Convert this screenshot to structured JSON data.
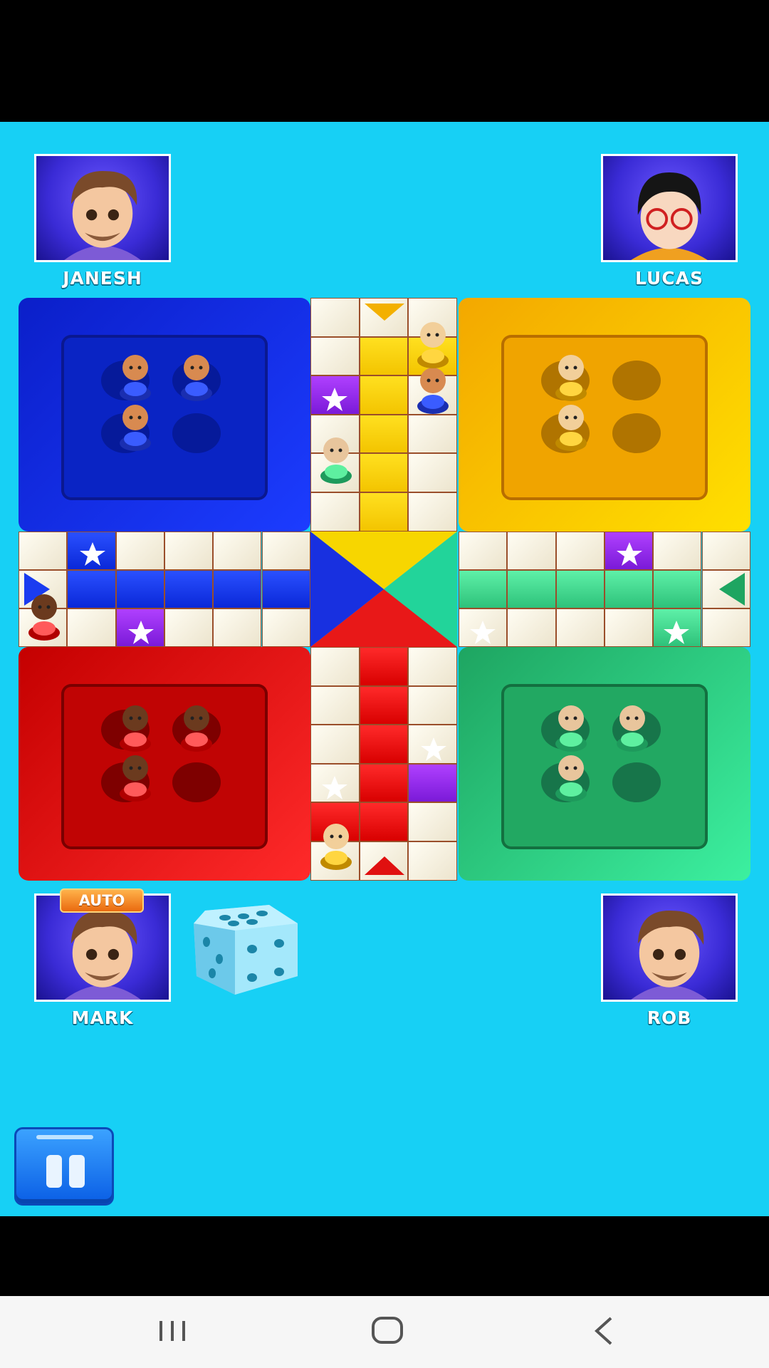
{
  "players": {
    "top_left": {
      "name": "JANESH"
    },
    "top_right": {
      "name": "LUCAS"
    },
    "bottom_left": {
      "name": "MARK",
      "badge": "AUTO"
    },
    "bottom_right": {
      "name": "ROB"
    }
  },
  "colors": {
    "background": "#17d0f5",
    "blue": "#0a2bd6",
    "yellow": "#f4b400",
    "red": "#e01010",
    "green": "#2ec27a"
  },
  "dice": {
    "value": 5
  },
  "controls": {
    "pause_icon": "pause-icon"
  },
  "system_nav": {
    "recent": "recent-apps-icon",
    "home": "home-icon",
    "back": "back-icon"
  }
}
